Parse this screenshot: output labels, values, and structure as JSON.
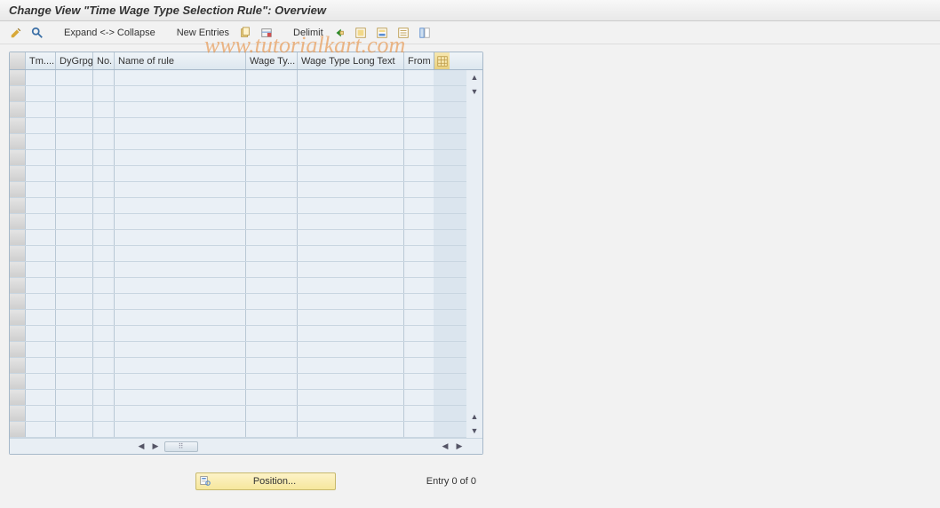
{
  "header": {
    "title": "Change View \"Time Wage Type Selection Rule\": Overview"
  },
  "toolbar": {
    "expand_collapse": "Expand <-> Collapse",
    "new_entries": "New Entries",
    "delimit": "Delimit"
  },
  "watermark": "www.tutorialkart.com",
  "table": {
    "columns": {
      "tm": "Tm....",
      "dygrpg": "DyGrpg",
      "no": "No.",
      "name": "Name of rule",
      "wagety": "Wage Ty...",
      "wagelong": "Wage Type Long Text",
      "from": "From"
    },
    "row_count": 23
  },
  "footer": {
    "position_label": "Position...",
    "entry_text": "Entry 0 of 0"
  }
}
